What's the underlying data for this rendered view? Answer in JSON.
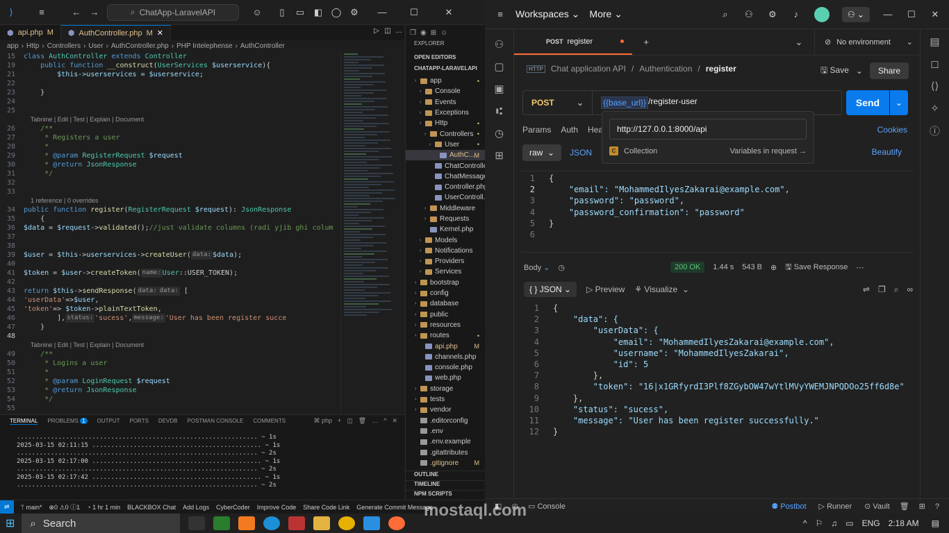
{
  "vscode": {
    "search": "ChatApp-LaravelAPI",
    "tabs": [
      {
        "label": "api.php",
        "mark": "M"
      },
      {
        "label": "AuthController.php",
        "mark": "M"
      }
    ],
    "breadcrumb": [
      "app",
      "Http",
      "Controllers",
      "User",
      "AuthController.php",
      "PHP Intelephense",
      "AuthController"
    ],
    "explorer_title": "EXPLORER",
    "open_editors": "OPEN EDITORS",
    "project": "CHATAPP-LARAVELAPI",
    "tree": [
      {
        "label": "app",
        "indent": 1,
        "type": "folder",
        "mark": "•"
      },
      {
        "label": "Console",
        "indent": 2,
        "type": "folder"
      },
      {
        "label": "Events",
        "indent": 2,
        "type": "folder"
      },
      {
        "label": "Exceptions",
        "indent": 2,
        "type": "folder"
      },
      {
        "label": "Http",
        "indent": 2,
        "type": "folder",
        "mark": "•"
      },
      {
        "label": "Controllers",
        "indent": 3,
        "type": "folder",
        "mark": "•"
      },
      {
        "label": "User",
        "indent": 4,
        "type": "folder",
        "mark": "•"
      },
      {
        "label": "AuthC...",
        "indent": 5,
        "type": "php",
        "mark": "M",
        "selected": true
      },
      {
        "label": "ChatControlle...",
        "indent": 4,
        "type": "php"
      },
      {
        "label": "ChatMessage...",
        "indent": 4,
        "type": "php"
      },
      {
        "label": "Controller.php",
        "indent": 4,
        "type": "php"
      },
      {
        "label": "UserControll...",
        "indent": 4,
        "type": "php"
      },
      {
        "label": "Middleware",
        "indent": 3,
        "type": "folder"
      },
      {
        "label": "Requests",
        "indent": 3,
        "type": "folder"
      },
      {
        "label": "Kernel.php",
        "indent": 3,
        "type": "php"
      },
      {
        "label": "Models",
        "indent": 2,
        "type": "folder"
      },
      {
        "label": "Notifications",
        "indent": 2,
        "type": "folder"
      },
      {
        "label": "Providers",
        "indent": 2,
        "type": "folder"
      },
      {
        "label": "Services",
        "indent": 2,
        "type": "folder"
      },
      {
        "label": "bootstrap",
        "indent": 1,
        "type": "folder"
      },
      {
        "label": "config",
        "indent": 1,
        "type": "folder"
      },
      {
        "label": "database",
        "indent": 1,
        "type": "folder"
      },
      {
        "label": "public",
        "indent": 1,
        "type": "folder"
      },
      {
        "label": "resources",
        "indent": 1,
        "type": "folder"
      },
      {
        "label": "routes",
        "indent": 1,
        "type": "folder",
        "mark": "•"
      },
      {
        "label": "api.php",
        "indent": 2,
        "type": "php",
        "mark": "M"
      },
      {
        "label": "channels.php",
        "indent": 2,
        "type": "php"
      },
      {
        "label": "console.php",
        "indent": 2,
        "type": "php"
      },
      {
        "label": "web.php",
        "indent": 2,
        "type": "php"
      },
      {
        "label": "storage",
        "indent": 1,
        "type": "folder"
      },
      {
        "label": "tests",
        "indent": 1,
        "type": "folder"
      },
      {
        "label": "vendor",
        "indent": 1,
        "type": "folder"
      },
      {
        "label": ".editorconfig",
        "indent": 1,
        "type": "file"
      },
      {
        "label": ".env",
        "indent": 1,
        "type": "file"
      },
      {
        "label": ".env.example",
        "indent": 1,
        "type": "file"
      },
      {
        "label": ".gitattributes",
        "indent": 1,
        "type": "file"
      },
      {
        "label": ".gitignore",
        "indent": 1,
        "type": "file",
        "mark": "M"
      }
    ],
    "outline": [
      "OUTLINE",
      "TIMELINE",
      "NPM SCRIPTS"
    ],
    "terminal_tabs": [
      "TERMINAL",
      "PROBLEMS",
      "OUTPUT",
      "PORTS",
      "DEVDB",
      "POSTMAN CONSOLE",
      "COMMENTS"
    ],
    "problems_count": "1",
    "terminal_shell": "php",
    "terminal_lines": [
      "................................................................ ~ 1s",
      "2025-03-15 02:11:15 ............................................. ~ 1s",
      "................................................................ ~ 2s",
      "2025-03-15 02:17:00 ............................................. ~ 1s",
      "................................................................ ~ 2s",
      "2025-03-15 02:17:42 ............................................. ~ 1s",
      "................................................................ ~ 2s"
    ],
    "status_items": [
      "main*",
      "⊗0 ⚠0  ⓘ1",
      "1 hr 1 min",
      "BLACKBOX Chat",
      "Add Logs",
      "CyberCoder",
      "Improve Code",
      "Share Code Link",
      "Generate Commit Message"
    ]
  },
  "postman": {
    "workspaces": "Workspaces",
    "more": "More",
    "tab_method": "POST",
    "tab_name": "register",
    "environment": "No environment",
    "breadcrumb": [
      "Chat application API",
      "Authentication",
      "register"
    ],
    "save": "Save",
    "share": "Share",
    "method": "POST",
    "url_var": "{{base_url}}",
    "url_path": "/register-user",
    "send": "Send",
    "tooltip_url": "http://127.0.0.1:8000/api",
    "tooltip_collection_badge": "C",
    "tooltip_collection": "Collection",
    "tooltip_vars": "Variables in request →",
    "req_tabs": [
      "Params",
      "Auth",
      "Hea"
    ],
    "cookies": "Cookies",
    "raw": "raw",
    "json": "JSON",
    "beautify": "Beautify",
    "request_body": [
      "{",
      "    \"email\": \"MohammedIlyesZakarai@example.com\",",
      "    \"password\": \"password\",",
      "    \"password_confirmation\": \"password\"",
      "}",
      ""
    ],
    "response_label": "Body",
    "status": "200 OK",
    "time": "1.44 s",
    "size": "543 B",
    "save_response": "Save Response",
    "resp_format": "{ } JSON",
    "preview": "Preview",
    "visualize": "Visualize",
    "response_body": [
      "{",
      "    \"data\": {",
      "        \"userData\": {",
      "            \"email\": \"MohammedIlyesZakarai@example.com\",",
      "            \"username\": \"MohammedIlyesZakarai\",",
      "            \"id\": 5",
      "        },",
      "        \"token\": \"16|x1GRfyrdI3Plf8ZGybOW47wYtlMVyYWEMJNPQDOo25ff6d8e\"",
      "    },",
      "    \"status\": \"sucess\",",
      "    \"message\": \"User has been register successfully.\"",
      "}"
    ],
    "footer": [
      "Console",
      "Postbot",
      "Runner",
      "Vault"
    ]
  },
  "taskbar": {
    "search": "Search",
    "lang": "ENG",
    "time": "2:18 AM"
  },
  "watermark": "mostaql.com"
}
